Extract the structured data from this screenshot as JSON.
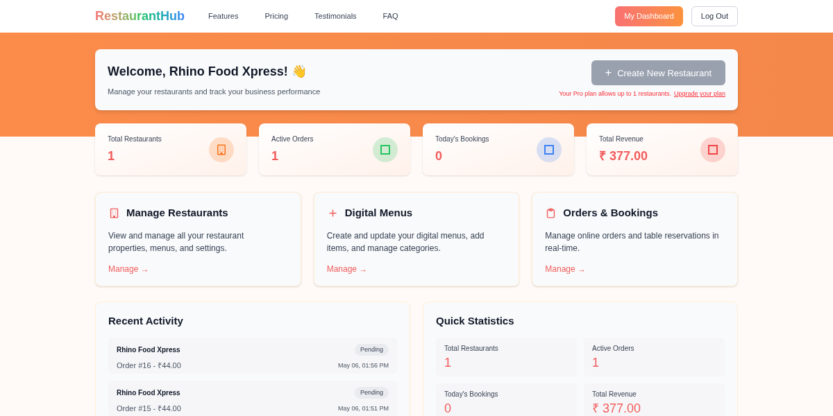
{
  "nav": {
    "logo": "RestaurantHub",
    "links": [
      "Features",
      "Pricing",
      "Testimonials",
      "FAQ"
    ],
    "primary_button": "My Dashboard",
    "secondary_button": "Log Out"
  },
  "welcome": {
    "title": "Welcome, Rhino Food Xpress! 👋",
    "subtitle": "Manage your restaurants and track your business performance",
    "create_icon": "+",
    "create_button": "Create New Restaurant",
    "create_disabled": true,
    "plan_note": "Your Pro plan allows up to 1 restaurants.",
    "upgrade_link": "Upgrade your plan"
  },
  "stats": [
    {
      "label": "Total Restaurants",
      "value": "1",
      "kind": "building",
      "color": "#f97316"
    },
    {
      "label": "Active Orders",
      "value": "1",
      "kind": "square",
      "color": "#22c55e"
    },
    {
      "label": "Today's Bookings",
      "value": "0",
      "kind": "square",
      "color": "#3b82f6"
    },
    {
      "label": "Total Revenue",
      "value": "₹ 377.00",
      "kind": "square",
      "color": "#ef4444"
    }
  ],
  "features": [
    {
      "kind": "building",
      "title": "Manage Restaurants",
      "description": "View and manage all your restaurant properties, menus, and settings.",
      "link": "Manage →"
    },
    {
      "kind": "plus",
      "title": "Digital Menus",
      "description": "Create and update your digital menus, add items, and manage categories.",
      "link": "Manage →"
    },
    {
      "kind": "clipboard",
      "title": "Orders & Bookings",
      "description": "Manage online orders and table reservations in real-time.",
      "link": "Manage →"
    }
  ],
  "recent_activity": {
    "title": "Recent Activity",
    "items": [
      {
        "name": "Rhino Food Xpress",
        "status": "Pending",
        "detail": "Order #16 - ₹44.00",
        "time": "May 06, 01:56 PM"
      },
      {
        "name": "Rhino Food Xpress",
        "status": "Pending",
        "detail": "Order #15 - ₹44.00",
        "time": "May 06, 01:51 PM"
      }
    ]
  },
  "quick_statistics": {
    "title": "Quick Statistics",
    "items": [
      {
        "label": "Total Restaurants",
        "value": "1"
      },
      {
        "label": "Active Orders",
        "value": "1"
      },
      {
        "label": "Today's Bookings",
        "value": "0"
      },
      {
        "label": "Total Revenue",
        "value": "₹ 377.00"
      }
    ]
  }
}
